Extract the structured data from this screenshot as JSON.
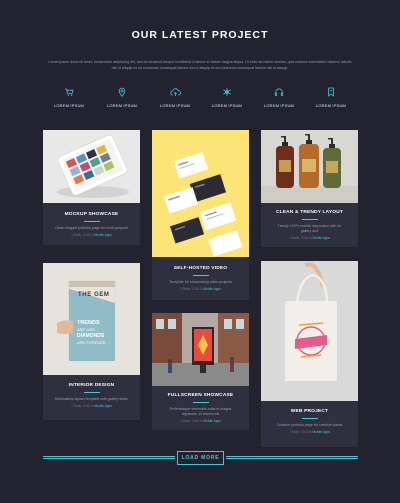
{
  "header": {
    "title": "OUR LATEST PROJECT",
    "intro": "Lorem ipsum dolor sit amet, consectetur adipiscing elit, sed do eiusmod tempor incididunt ut labore et dolore magna aliqua. Ut enim ad minim veniam, quis nostrud exercitation ullamco laboris nisi ut aliquip ex ea commodo consequat laboris nisi ut aliquip ex ea commodo consequat laboris nisi ut aliquip."
  },
  "categories": [
    {
      "label": "LOREM IPSUM",
      "icon": "cart-icon"
    },
    {
      "label": "LOREM IPSUM",
      "icon": "map-pin-icon"
    },
    {
      "label": "LOREM IPSUM",
      "icon": "cloud-upload-icon"
    },
    {
      "label": "LOREM IPSUM",
      "icon": "snowflake-icon"
    },
    {
      "label": "LOREM IPSUM",
      "icon": "headphones-icon"
    },
    {
      "label": "LOREM IPSUM",
      "icon": "bookmark-icon"
    }
  ],
  "projects": [
    {
      "title": "MOCKUP SHOWCASE",
      "desc": "Clean elegant portfolio page for multi-purpose",
      "meta": "1 Ratio, 2018 In",
      "link": "Mobile Apps"
    },
    {
      "title": "SELF-HOSTED VIDEO",
      "desc": "Template for showcasing video projects",
      "meta": "1 Ratio, 2018 In",
      "link": "Mobile Apps"
    },
    {
      "title": "CLEAN & TRENDY LAYOUT",
      "desc": "Trendy 100% mobile responsive with 2x gallery and",
      "meta": "1 Ratio, 2018 In",
      "link": "Mobile Apps"
    },
    {
      "title": "INTERIOR DESIGN",
      "desc": "Minimalistic stylish template with gallery slider",
      "meta": "1 Ratio, 2018 In",
      "link": "Mobile Apps"
    },
    {
      "title": "FULLSCREEN SHOWCASE",
      "desc": "Pellentesque venenatis nulla et magna dignissim, et viverra elit",
      "meta": "1 Ratio, 2018 In",
      "link": "Mobile Apps"
    },
    {
      "title": "WEB PROJECT",
      "desc": "Creative portfolio page for creative teams",
      "meta": "1 Ratio, 2018 In",
      "link": "Mobile Apps"
    }
  ],
  "book_cover": {
    "top": "THE GEM",
    "lines": [
      "TRENDS",
      "ARE LIKE",
      "DIAMONDS",
      "ARE FOREVER."
    ]
  },
  "load_more": "LOAD MORE",
  "colors": {
    "background": "#23232f",
    "card": "#2f2f3f",
    "accent": "#46c6d6",
    "yellow": "#fce476"
  }
}
